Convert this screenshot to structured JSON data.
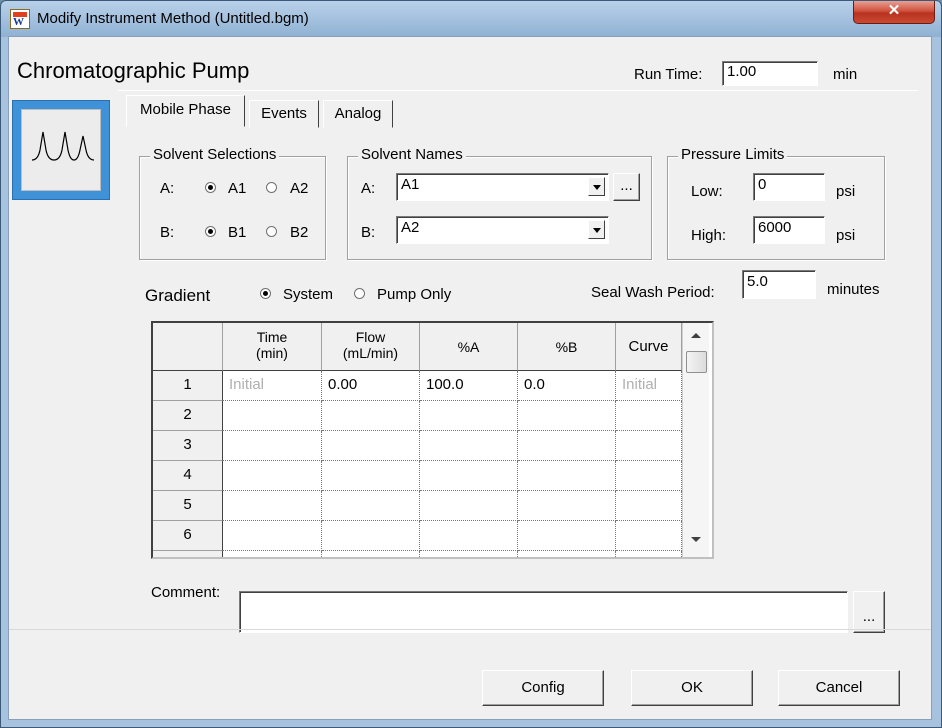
{
  "window": {
    "title": "Modify Instrument Method (Untitled.bgm)",
    "close_glyph": "✕"
  },
  "header": {
    "title": "Chromatographic Pump",
    "run_time_label": "Run Time:",
    "run_time_value": "1.00",
    "run_time_unit": "min"
  },
  "tabs": [
    {
      "label": "Mobile Phase",
      "active": true
    },
    {
      "label": "Events"
    },
    {
      "label": "Analog"
    }
  ],
  "solvent_selections": {
    "title": "Solvent Selections",
    "a_label": "A:",
    "a_options": [
      "A1",
      "A2"
    ],
    "a_selected": "A1",
    "b_label": "B:",
    "b_options": [
      "B1",
      "B2"
    ],
    "b_selected": "B1"
  },
  "solvent_names": {
    "title": "Solvent Names",
    "a_label": "A:",
    "a_value": "A1",
    "b_label": "B:",
    "b_value": "A2",
    "browse_label": "..."
  },
  "pressure_limits": {
    "title": "Pressure Limits",
    "low_label": "Low:",
    "low_value": "0",
    "high_label": "High:",
    "high_value": "6000",
    "unit": "psi"
  },
  "gradient": {
    "label": "Gradient",
    "options": [
      "System",
      "Pump Only"
    ],
    "selected": "System"
  },
  "seal_wash": {
    "label": "Seal Wash Period:",
    "value": "5.0",
    "unit": "minutes"
  },
  "table": {
    "columns": [
      {
        "line1": "Time",
        "line2": "(min)"
      },
      {
        "line1": "Flow",
        "line2": "(mL/min)"
      },
      {
        "line1": "%A",
        "line2": ""
      },
      {
        "line1": "%B",
        "line2": ""
      },
      {
        "line1": "Curve",
        "line2": ""
      }
    ],
    "rows": [
      {
        "num": "1",
        "cells": [
          "Initial",
          "0.00",
          "100.0",
          "0.0",
          "Initial"
        ]
      },
      {
        "num": "2",
        "cells": [
          "",
          "",
          "",
          "",
          ""
        ]
      },
      {
        "num": "3",
        "cells": [
          "",
          "",
          "",
          "",
          ""
        ]
      },
      {
        "num": "4",
        "cells": [
          "",
          "",
          "",
          "",
          ""
        ]
      },
      {
        "num": "5",
        "cells": [
          "",
          "",
          "",
          "",
          ""
        ]
      },
      {
        "num": "6",
        "cells": [
          "",
          "",
          "",
          "",
          ""
        ]
      }
    ]
  },
  "comment": {
    "label": "Comment:",
    "value": "",
    "browse_label": "..."
  },
  "buttons": {
    "config": "Config",
    "ok": "OK",
    "cancel": "Cancel"
  },
  "colors": {
    "logo_bg": "#3f92d8",
    "close_red": "#c84a34",
    "client_bg": "#f0f0f0"
  },
  "icons": {
    "app": "instrument-method-icon",
    "pump": "chromatogram-peaks-icon"
  }
}
